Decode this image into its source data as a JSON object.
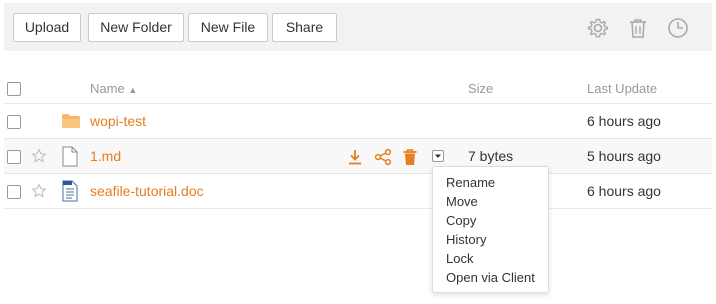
{
  "toolbar": {
    "upload": "Upload",
    "new_folder": "New Folder",
    "new_file": "New File",
    "share": "Share",
    "icons": [
      "gear-icon",
      "trash-icon",
      "clock-icon"
    ]
  },
  "table": {
    "headers": {
      "name": "Name",
      "size": "Size",
      "last_update": "Last Update"
    },
    "rows": [
      {
        "name": "wopi-test",
        "type": "folder",
        "size": "",
        "last_update": "6 hours ago"
      },
      {
        "name": "1.md",
        "type": "file",
        "size": "7 bytes",
        "last_update": "5 hours ago"
      },
      {
        "name": "seafile-tutorial.doc",
        "type": "doc",
        "size": "",
        "last_update": "6 hours ago"
      }
    ]
  },
  "context_menu": {
    "items": [
      "Rename",
      "Move",
      "Copy",
      "History",
      "Lock",
      "Open via Client"
    ]
  },
  "colors": {
    "accent": "#e67e22",
    "toolbar_bg": "#f2f2f2",
    "header_text": "#999999",
    "icon_gray": "#aaaaaa"
  }
}
